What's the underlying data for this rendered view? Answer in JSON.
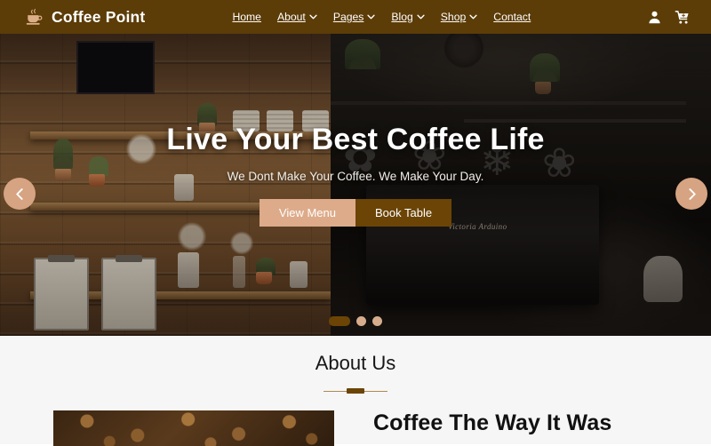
{
  "header": {
    "logo_icon": "coffee-cup-icon",
    "brand_name": "Coffee Point",
    "nav": [
      {
        "label": "Home",
        "has_dropdown": false
      },
      {
        "label": "About",
        "has_dropdown": true
      },
      {
        "label": "Pages",
        "has_dropdown": true
      },
      {
        "label": "Blog",
        "has_dropdown": true
      },
      {
        "label": "Shop",
        "has_dropdown": true
      },
      {
        "label": "Contact",
        "has_dropdown": false
      }
    ],
    "account_icon": "user-icon",
    "cart_icon": "cart-add-icon",
    "bg_color": "#5c3c07"
  },
  "hero": {
    "title": "Live Your Best Coffee Life",
    "subtitle": "We Dont Make Your Coffee. We Make Your Day.",
    "primary_button": "View Menu",
    "secondary_button": "Book Table",
    "primary_color": "#ddab8a",
    "secondary_color": "#6b4406",
    "prev_icon": "chevron-left-icon",
    "next_icon": "chevron-right-icon",
    "slide_count": 3,
    "active_slide": 1,
    "left_image_alt": "rustic wooden cafe wall with shelves, plants and menu clipboards",
    "right_image_alt": "dark cafe interior with Victoria Arduino espresso machine",
    "machine_brand": "Victoria Arduino"
  },
  "about": {
    "section_title": "About Us",
    "accent_color": "#6b4406",
    "heading": "Coffee The Way It Was",
    "image_alt": "roasted coffee beans",
    "bg_color": "#f6f6f6"
  }
}
